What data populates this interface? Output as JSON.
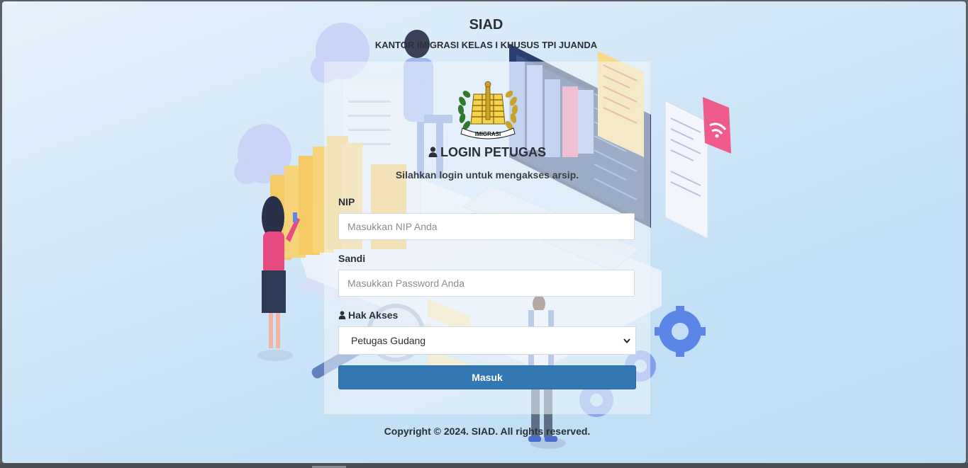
{
  "header": {
    "title": "SIAD",
    "subtitle": "KANTOR IMIGRASI KELAS I KHUSUS TPI JUANDA"
  },
  "logo": {
    "text": "IMIGRASI"
  },
  "login": {
    "title": "LOGIN PETUGAS",
    "description": "Silahkan login untuk mengakses arsip.",
    "title_icon": "user-icon"
  },
  "form": {
    "nip_label": "NIP",
    "nip_placeholder": "Masukkan NIP Anda",
    "nip_value": "",
    "password_label": "Sandi",
    "password_placeholder": "Masukkan Password Anda",
    "password_value": "",
    "access_label": "Hak Akses",
    "access_icon": "user-icon",
    "access_selected": "Petugas Gudang",
    "submit_label": "Masuk"
  },
  "footer": {
    "copyright": "Copyright © 2024. SIAD. All rights reserved."
  },
  "colors": {
    "primary_button": "#3377b3",
    "background": "#c8e3f7",
    "text": "#2b2f36"
  }
}
